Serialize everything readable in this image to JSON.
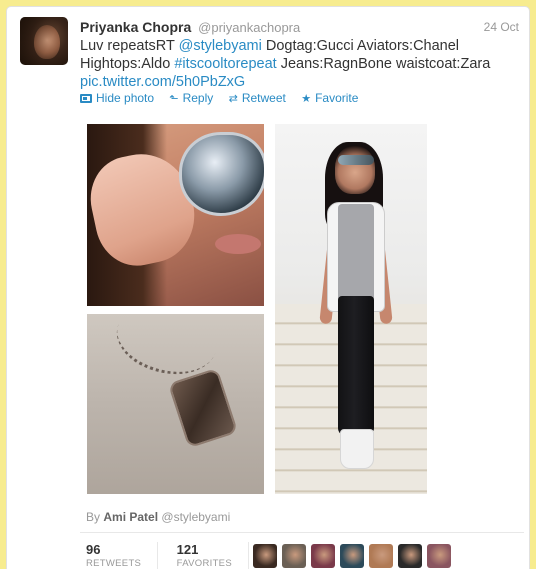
{
  "tweet": {
    "author_name": "Priyanka Chopra",
    "author_handle": "@priyankachopra",
    "date": "24 Oct",
    "text_parts": {
      "p1": "Luv repeatsRT ",
      "mention": "@stylebyami",
      "p2": " Dogtag:Gucci Aviators:Chanel Hightops:Aldo ",
      "hashtag": "#itscooltorepeat",
      "p3": " Jeans:RagnBone waistcoat:Zara ",
      "link": "pic.twitter.com/5h0PbZxG"
    },
    "link_color": "#2a8bc4"
  },
  "actions": {
    "hide_photo": "Hide photo",
    "reply": "Reply",
    "retweet": "Retweet",
    "favorite": "Favorite",
    "icons": [
      "photo-icon",
      "reply-arrow-icon",
      "retweet-icon",
      "star-icon"
    ]
  },
  "byline": {
    "prefix": "By",
    "name": "Ami Patel",
    "handle": "@stylebyami"
  },
  "stats": {
    "retweets_count": "96",
    "retweets_label": "RETWEETS",
    "favorites_count": "121",
    "favorites_label": "FAVORITES"
  },
  "faces": [
    {
      "color": "#3a2a22"
    },
    {
      "color": "#6b6055"
    },
    {
      "color": "#7a3a4a"
    },
    {
      "color": "#2c4a5a"
    },
    {
      "color": "#b07a55"
    },
    {
      "color": "#2a2a2a"
    },
    {
      "color": "#8a5560"
    }
  ],
  "colors": {
    "background": "#f7ec8f",
    "card": "#ffffff",
    "accent": "#2a8bc4"
  }
}
